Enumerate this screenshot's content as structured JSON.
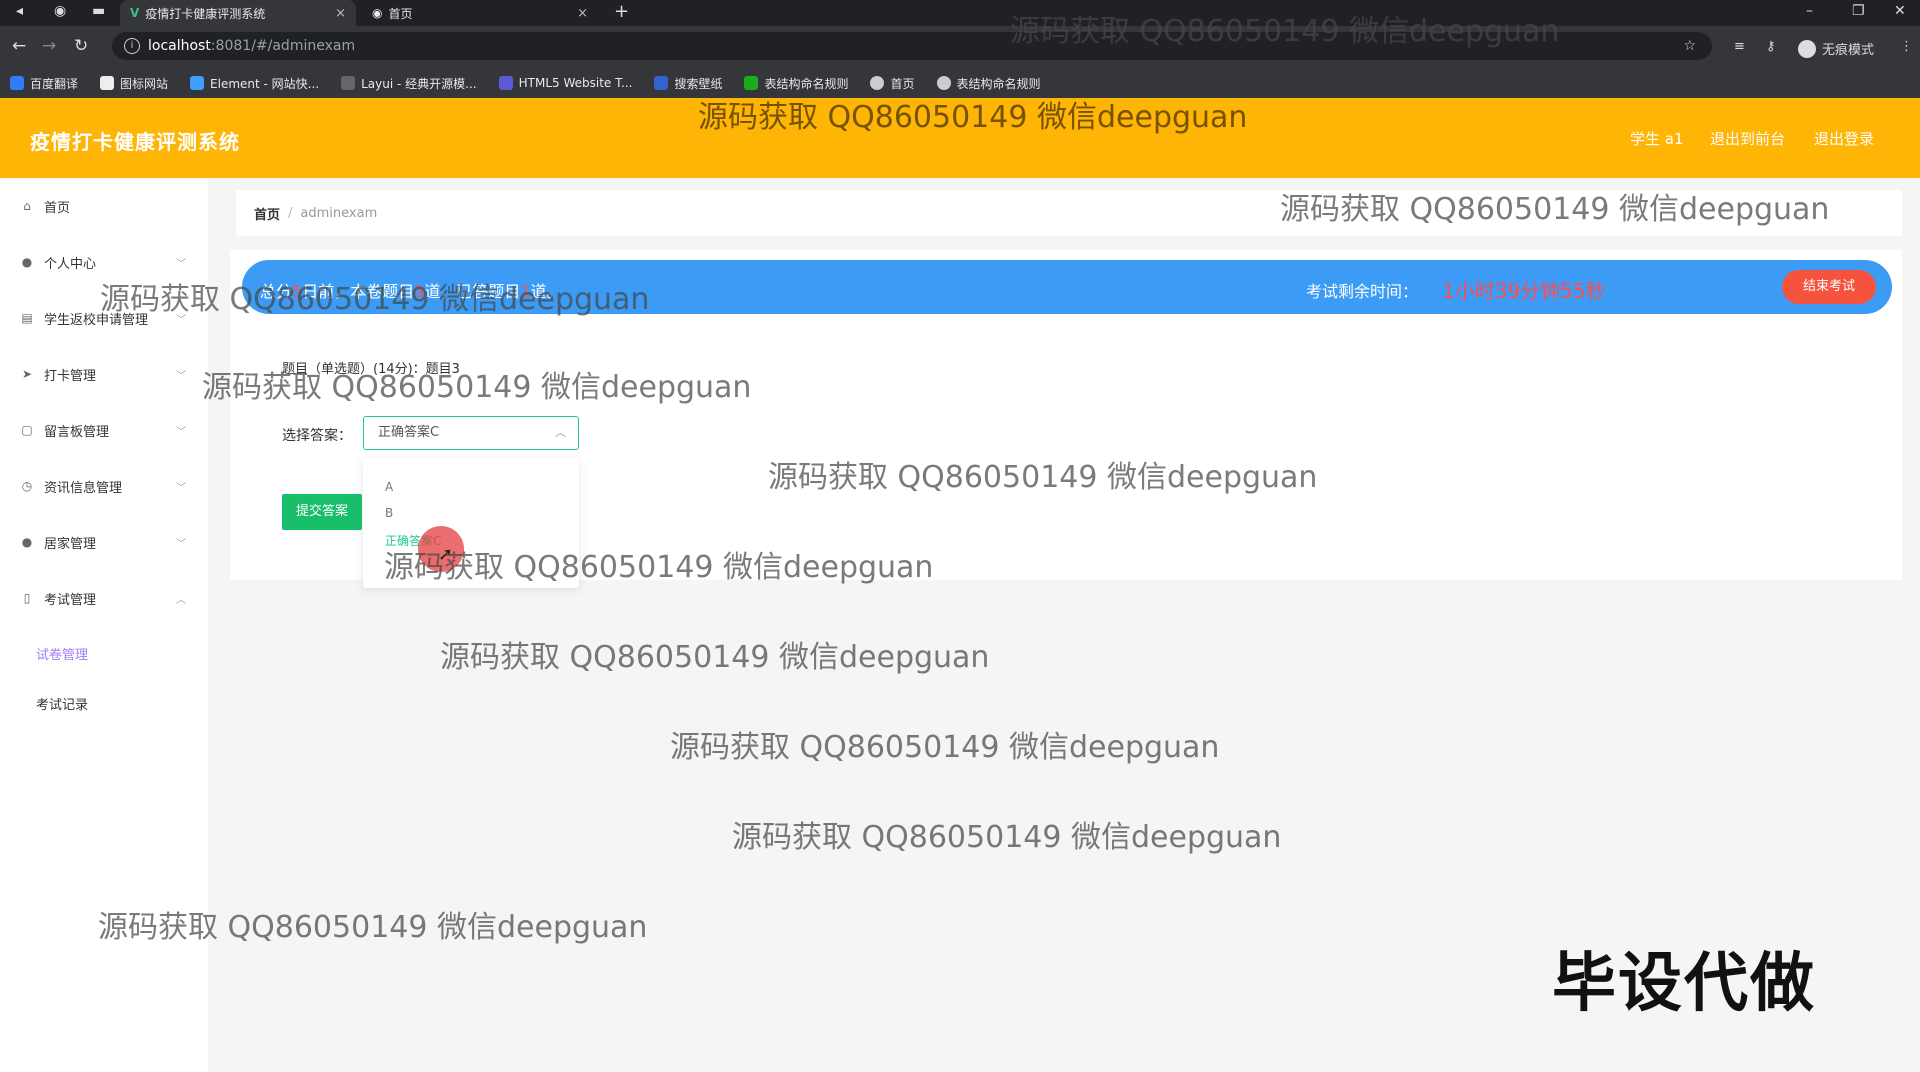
{
  "browser": {
    "tabs": [
      {
        "title": "疫情打卡健康评测系统",
        "close": "×"
      },
      {
        "title": "首页",
        "close": "×"
      }
    ],
    "new_tab": "+",
    "url_host": "localhost",
    "url_path": ":8081/#/adminexam",
    "profile_label": "无痕模式",
    "bookmarks": [
      "百度翻译",
      "图标网站",
      "Element - 网站快...",
      "Layui - 经典开源模...",
      "HTML5 Website T...",
      "搜索壁纸",
      "表结构命名规则",
      "首页",
      "表结构命名规则"
    ]
  },
  "header": {
    "title": "疫情打卡健康评测系统",
    "user": "学生 a1",
    "to_front": "退出到前台",
    "logout": "退出登录"
  },
  "sidebar": {
    "items": [
      {
        "label": "首页",
        "icon": "home-icon"
      },
      {
        "label": "个人中心",
        "icon": "user-icon"
      },
      {
        "label": "学生返校申请管理",
        "icon": "clipboard-icon"
      },
      {
        "label": "打卡管理",
        "icon": "send-icon"
      },
      {
        "label": "留言板管理",
        "icon": "message-icon"
      },
      {
        "label": "资讯信息管理",
        "icon": "clock-icon"
      },
      {
        "label": "居家管理",
        "icon": "user-icon"
      },
      {
        "label": "考试管理",
        "icon": "phone-icon"
      }
    ],
    "sub_items": [
      "试卷管理",
      "考试记录"
    ]
  },
  "breadcrumb": {
    "home": "首页",
    "current": "adminexam"
  },
  "exam": {
    "banner_pre": "总分",
    "banner_score": "5",
    "banner_mid": "日前，本卷题目",
    "banner_total": "3",
    "banner_mid2": "道，已答题目",
    "banner_done": "1",
    "banner_post": "道。",
    "timer_label": "考试剩余时间：",
    "timer_value": "1小时39分钟55秒",
    "end_button": "结束考试",
    "question_title": "题目（单选题）(14分)：题目3",
    "answer_label": "选择答案：",
    "selected": "正确答案C",
    "options": [
      "A",
      "B",
      "正确答案C"
    ],
    "submit_button": "提交答案"
  },
  "watermark_text": "源码获取 QQ86050149 微信deepguan",
  "corner_mark": "毕设代做",
  "colors": {
    "header": "#ffb506",
    "banner": "#3b9bf5",
    "accent": "#20c997",
    "danger": "#f5533d"
  }
}
